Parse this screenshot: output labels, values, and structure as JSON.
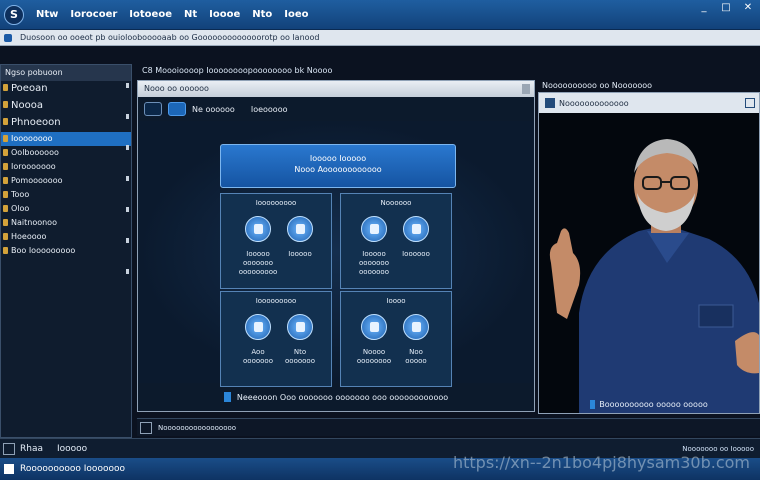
{
  "topbar": {
    "menus": [
      "Ntw",
      "Iorocoer",
      "Iotoeoe",
      "Nt",
      "Ioooe",
      "Nto",
      "Ioeo"
    ],
    "logo_text": "S",
    "controls": [
      "_",
      "□",
      "✕"
    ]
  },
  "address": {
    "text": "Duosoon oo ooeot pb ouioloobooooaab oo Gooooooooooooorotp oo lanood"
  },
  "sidebar": {
    "title": "Ngso pobuoon",
    "items": [
      {
        "label": "Poeoan",
        "big": true
      },
      {
        "label": "Noooa",
        "big": true
      },
      {
        "label": "Phnoeoon",
        "big": true
      },
      {
        "label": "Ioooooooo",
        "selected": true
      },
      {
        "label": "Oolboooooo"
      },
      {
        "label": "Iorooooooo"
      },
      {
        "label": "Pomooooooo"
      },
      {
        "label": "Tooo"
      },
      {
        "label": "Oloo"
      },
      {
        "label": "Naitnoonoo"
      },
      {
        "label": "Hoeoooo"
      },
      {
        "label": "Boo Iooooooooo"
      }
    ]
  },
  "center": {
    "title": "C8 Moooioooop Ioooooooopoooooooo bk Noooo",
    "head": "Nooo oo oooooo",
    "toolbar_text_1": "Ne oooooo",
    "toolbar_text_2": "Ioeooooo",
    "header_line_1": "Iooooo Iooooo",
    "header_line_2": "Nooo Aoooooooooooo",
    "cards": [
      {
        "title": "Iooooooooo",
        "labels": [
          "Iooooo\nooooooo\nooooooooo",
          "Iooooo"
        ]
      },
      {
        "title": "Noooooo",
        "labels": [
          "Iooooo\nooooooo\nooooooo",
          "Ioooooo"
        ]
      },
      {
        "title": "Iooooooooo",
        "labels": [
          "Aoo\nooooooo",
          "Nto\nooooooo"
        ]
      },
      {
        "title": "Ioooo",
        "labels": [
          "Noooo\noooooooo",
          "Noo\nooooo"
        ]
      }
    ],
    "footer": "Neeeooon Ooo ooooooo ooooooo ooo oooooooooooo"
  },
  "video": {
    "label": "Noooooooooo oo Nooooooo",
    "head": "Nooooooooooooo",
    "caption": "Boooooooooo ooooo ooooo"
  },
  "status1": {
    "text": "Nooooooooooooooooo"
  },
  "status2": {
    "left": "Rhaa",
    "mid": "Iooooo",
    "right": "Nooooooo oo Iooooo"
  },
  "taskbar": {
    "label": "Roooooooooo Iooooooo"
  },
  "watermark": "https://xn--2n1bo4pj8hysam30b.com",
  "colors": {
    "accent": "#1f6fc2",
    "panel": "#0c1a2c",
    "titlebar": "#1f5ea0"
  }
}
